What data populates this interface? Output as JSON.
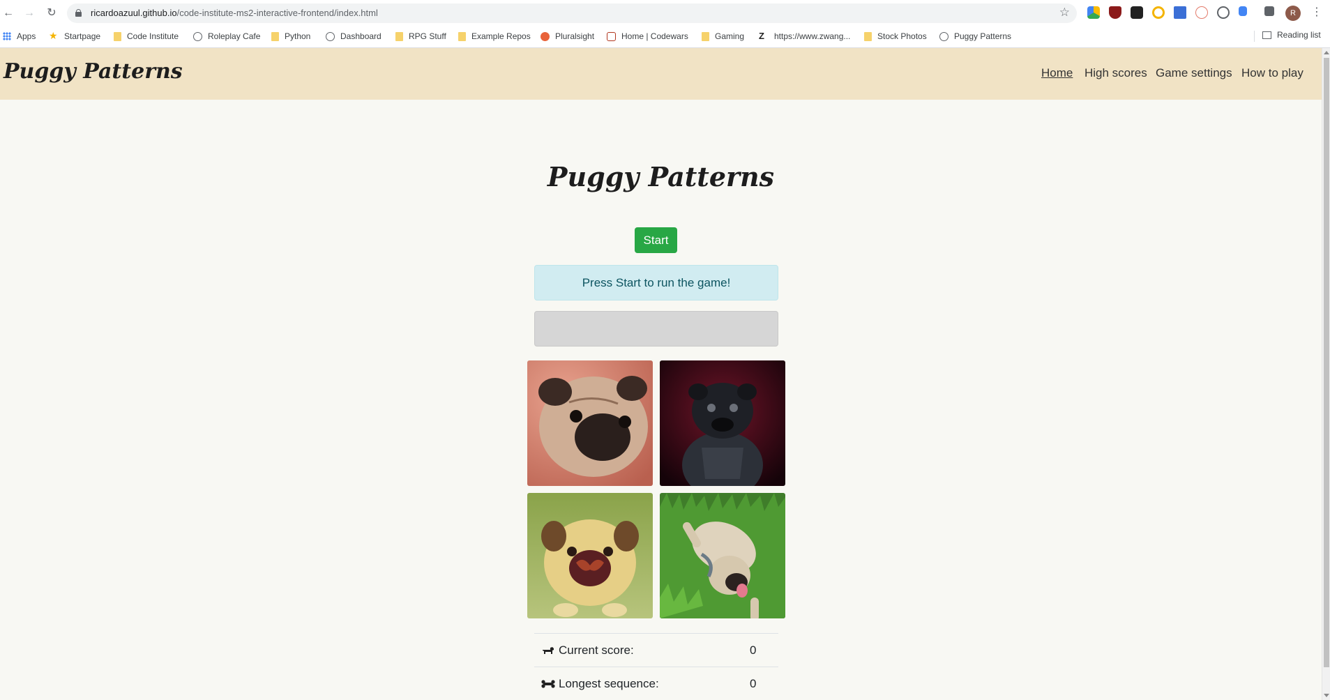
{
  "browser": {
    "url_host": "ricardoazuul.github.io",
    "url_path": "/code-institute-ms2-interactive-frontend/index.html",
    "avatar_letter": "R",
    "bookmarks": [
      {
        "label": "Apps",
        "icon": "apps-icon"
      },
      {
        "label": "Startpage",
        "icon": "star-icon"
      },
      {
        "label": "Code Institute",
        "icon": "folder-icon"
      },
      {
        "label": "Roleplay Cafe",
        "icon": "globe-icon"
      },
      {
        "label": "Python",
        "icon": "folder-icon"
      },
      {
        "label": "Dashboard",
        "icon": "globe-icon"
      },
      {
        "label": "RPG Stuff",
        "icon": "folder-icon"
      },
      {
        "label": "Example Repos",
        "icon": "folder-icon"
      },
      {
        "label": "Pluralsight",
        "icon": "pluralsight-icon"
      },
      {
        "label": "Home | Codewars",
        "icon": "codewars-icon"
      },
      {
        "label": "Gaming",
        "icon": "folder-icon"
      },
      {
        "label": "https://www.zwang...",
        "icon": "z-icon"
      },
      {
        "label": "Stock Photos",
        "icon": "folder-icon"
      },
      {
        "label": "Puggy Patterns",
        "icon": "globe-icon"
      }
    ],
    "reading_list": "Reading list"
  },
  "site": {
    "brand": "Puggy Patterns",
    "nav": [
      {
        "label": "Home",
        "active": true
      },
      {
        "label": "High scores",
        "active": false
      },
      {
        "label": "Game settings",
        "active": false
      },
      {
        "label": "How to play",
        "active": false
      }
    ]
  },
  "game": {
    "title": "Puggy Patterns",
    "start_label": "Start",
    "message": "Press Start to run the game!",
    "sequence_display": "",
    "tiles": [
      {
        "name": "pug-tile-1",
        "description_icon": "fawn-pug-photo"
      },
      {
        "name": "pug-tile-2",
        "description_icon": "black-pug-photo"
      },
      {
        "name": "pug-tile-3",
        "description_icon": "butterfly-pug-photo"
      },
      {
        "name": "pug-tile-4",
        "description_icon": "grass-pug-photo"
      }
    ],
    "stats": [
      {
        "label": "Current score:",
        "value": "0",
        "icon": "dog-icon"
      },
      {
        "label": "Longest sequence:",
        "value": "0",
        "icon": "bone-icon"
      }
    ]
  },
  "colors": {
    "navbar_bg": "#f1e3c5",
    "page_bg": "#f8f8f3",
    "start_button": "#28a745",
    "alert_bg": "#d1ecf1",
    "sequence_bg": "#d6d6d6"
  }
}
